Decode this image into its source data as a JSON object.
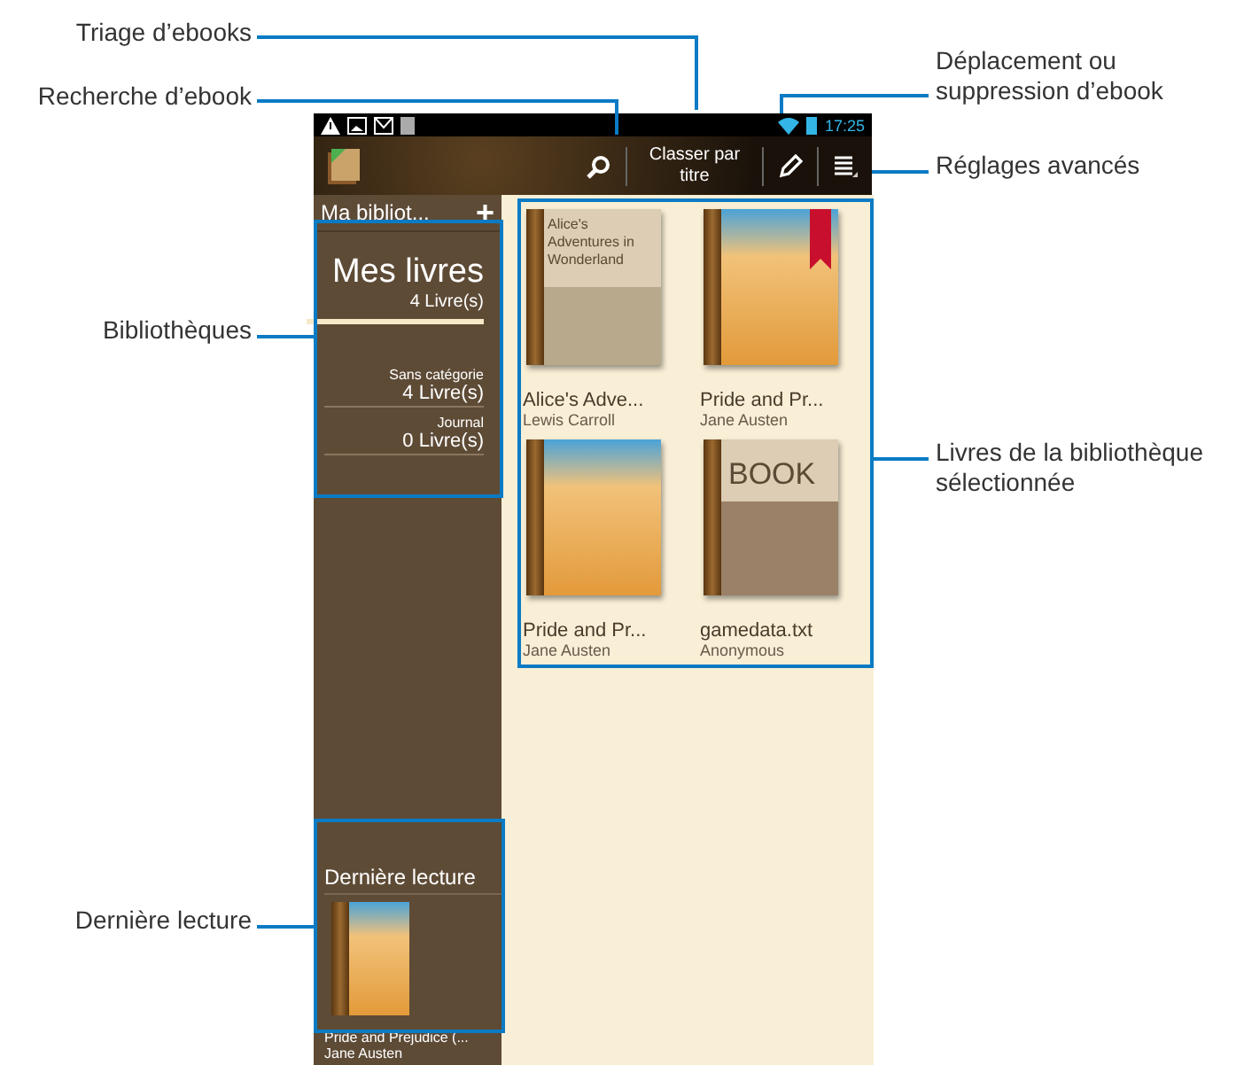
{
  "left_callouts": [
    "Triage d’ebooks",
    "Recherche d’ebook",
    "Bibliothèques",
    "Dernière lecture"
  ],
  "right_callouts": [
    "Déplacement ou suppression d’ebook",
    "Réglages avancés",
    "Livres de la bibliothèque sélectionnée"
  ],
  "status_bar": {
    "time": "17:25"
  },
  "action_bar": {
    "sort_button": "Classer par titre"
  },
  "sidebar": {
    "title": "Ma bibliot...",
    "plus": "+",
    "libraries": [
      {
        "name": "Mes livres",
        "count": "4 Livre(s)",
        "selected": true
      },
      {
        "name": "Sans catégorie",
        "count": "4 Livre(s)",
        "selected": false
      },
      {
        "name": "Journal",
        "count": "0 Livre(s)",
        "selected": false
      }
    ],
    "last_read": {
      "title": "Dernière lecture",
      "book_title": "Pride and Prejudice (...",
      "author": "Jane Austen"
    }
  },
  "books": [
    {
      "title": "Alice's Adve...",
      "author": "Lewis Carroll",
      "kind": "text",
      "cover_text": "Alice's Adventures in Wonderland",
      "bookmarked": false
    },
    {
      "title": "Pride and Pr...",
      "author": "Jane Austen",
      "kind": "art",
      "bookmarked": true
    },
    {
      "title": "Pride and Pr...",
      "author": "Jane Austen",
      "kind": "art",
      "bookmarked": false
    },
    {
      "title": "gamedata.txt",
      "author": "Anonymous",
      "kind": "plain",
      "cover_text": "BOOK",
      "bookmarked": false
    }
  ]
}
